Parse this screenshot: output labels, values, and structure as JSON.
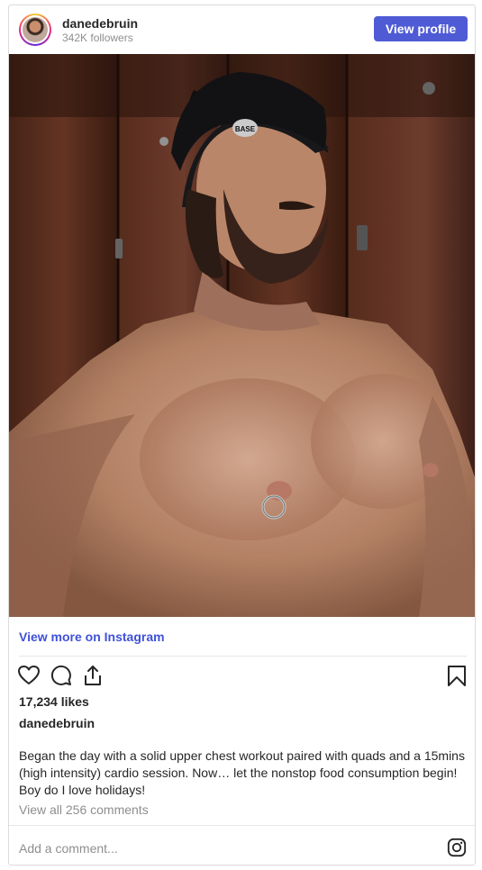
{
  "header": {
    "username": "danedebruin",
    "followers": "342K followers",
    "view_profile_label": "View profile"
  },
  "post": {
    "view_more_label": "View more on Instagram",
    "likes": "17,234 likes",
    "author": "danedebruin",
    "caption": "Began the day with a solid upper chest workout paired with quads and a 15mins (high intensity) cardio session. Now… let the nonstop food consumption begin! Boy do I love holidays!",
    "view_comments": "View all 256 comments"
  },
  "comment": {
    "placeholder": "Add a comment..."
  },
  "icons": {
    "like": "heart-icon",
    "comment": "comment-icon",
    "share": "share-icon",
    "save": "bookmark-icon",
    "instagram": "instagram-icon"
  },
  "colors": {
    "accent": "#4f5bd5",
    "link": "#3f51d8",
    "muted": "#8e8e8e"
  }
}
